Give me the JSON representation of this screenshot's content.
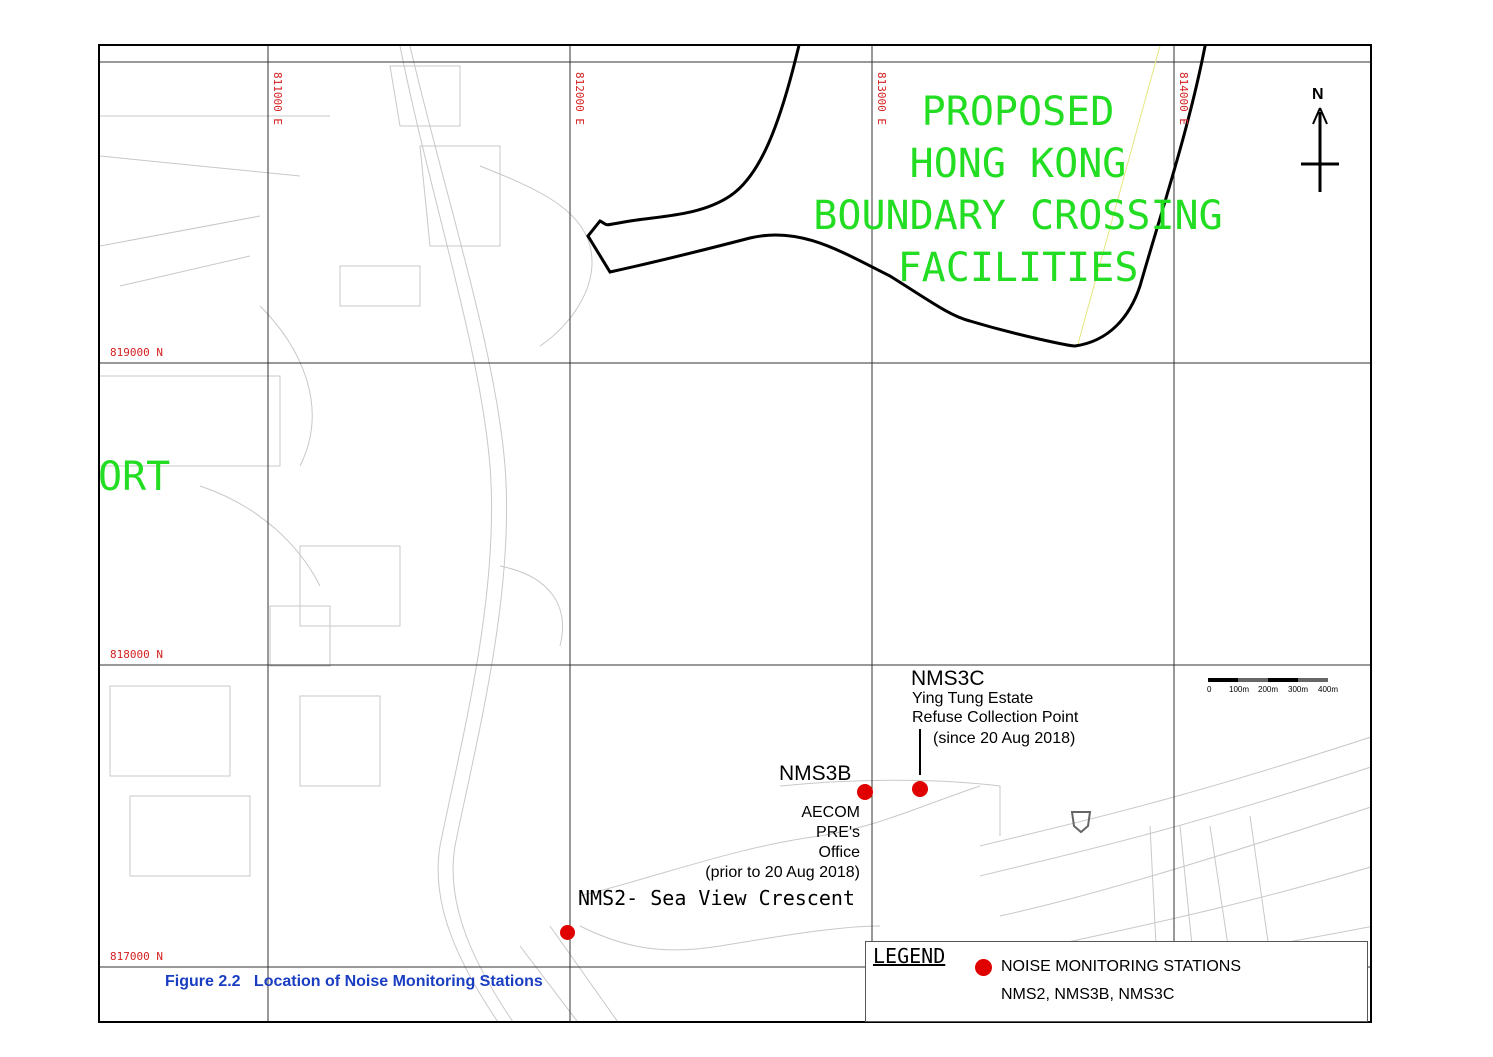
{
  "map": {
    "grid_labels": {
      "east": [
        "811000 E",
        "812000 E",
        "813000 E",
        "814000 E"
      ],
      "north": [
        "819000 N",
        "818000 N",
        "817000 N"
      ]
    },
    "proposed_area_lines": [
      "PROPOSED",
      "HONG KONG",
      "BOUNDARY CROSSING",
      "FACILITIES"
    ],
    "airport_fragment": "ORT",
    "north_label": "N",
    "scale_labels": [
      "0",
      "100m",
      "200m",
      "300m",
      "400m"
    ],
    "colors": {
      "station": "#e00000",
      "proposed_text": "#22dd22",
      "grid_label": "#d42020",
      "caption": "#1a3ec2"
    },
    "icons": [
      "north-arrow-icon",
      "station-marker-icon",
      "scale-bar-icon"
    ]
  },
  "stations": {
    "nms3c": {
      "id": "NMS3C",
      "line1": "Ying Tung Estate",
      "line2": "Refuse Collection Point",
      "line3": "(since 20 Aug 2018)"
    },
    "nms3b": {
      "id": "NMS3B",
      "line1": "AECOM",
      "line2": "PRE's",
      "line3": "Office",
      "line4": "(prior to 20 Aug 2018)"
    },
    "nms2": {
      "label": "NMS2- Sea View Crescent"
    }
  },
  "figure_caption": "Figure 2.2   Location of Noise Monitoring Stations",
  "legend": {
    "title": "LEGEND",
    "item_label": "NOISE MONITORING STATIONS",
    "item_detail": "NMS2, NMS3B, NMS3C"
  }
}
